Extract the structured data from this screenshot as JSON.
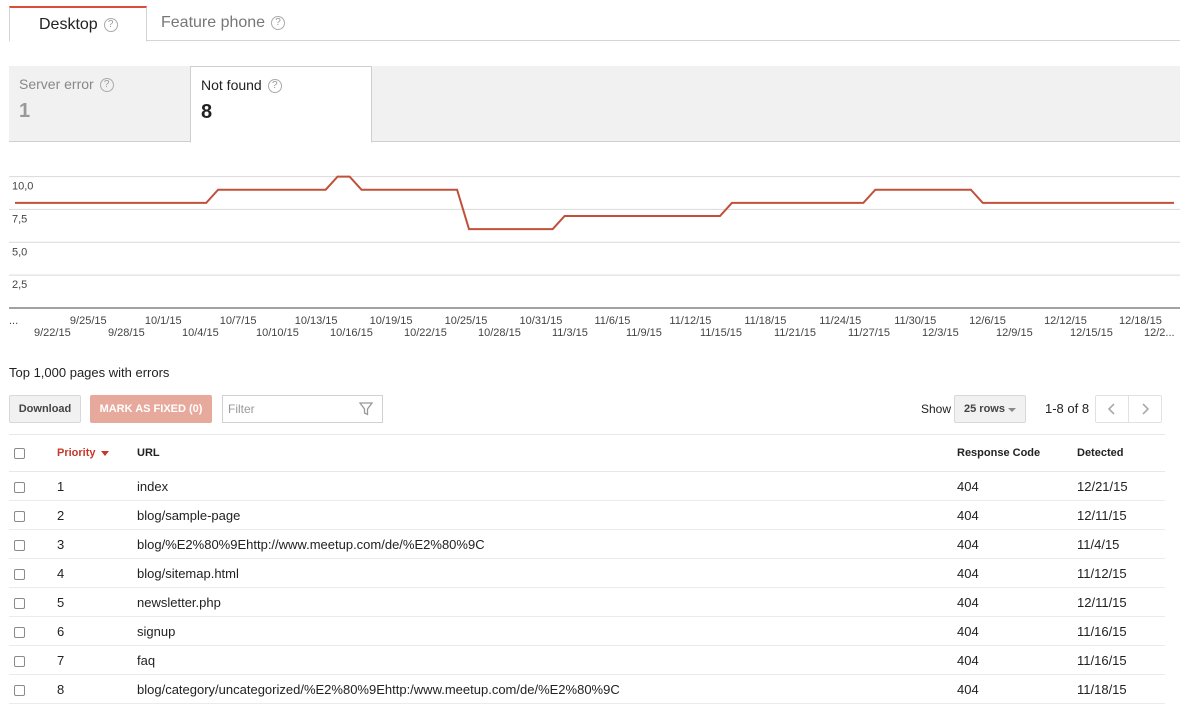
{
  "device_tabs": [
    {
      "label": "Desktop",
      "active": true
    },
    {
      "label": "Feature phone",
      "active": false
    }
  ],
  "help_glyph": "?",
  "error_tabs": [
    {
      "label": "Server error",
      "count": "1",
      "active": false
    },
    {
      "label": "Not found",
      "count": "8",
      "active": true
    }
  ],
  "colors": {
    "accent": "#dd4b39",
    "line": "#c0503a",
    "grid": "#d9d9d9"
  },
  "chart_data": {
    "type": "line",
    "y_ticks": [
      "10,0",
      "7,5",
      "5,0",
      "2,5"
    ],
    "ylim": [
      0,
      10.5
    ],
    "x_ticks_upper": [
      "...",
      "9/25/15",
      "10/1/15",
      "10/7/15",
      "10/13/15",
      "10/19/15",
      "10/25/15",
      "10/31/15",
      "11/6/15",
      "11/12/15",
      "11/18/15",
      "11/24/15",
      "11/30/15",
      "12/6/15",
      "12/12/15",
      "12/18/15"
    ],
    "x_ticks_lower": [
      "9/22/15",
      "9/28/15",
      "10/4/15",
      "10/10/15",
      "10/16/15",
      "10/22/15",
      "10/28/15",
      "11/3/15",
      "11/9/15",
      "11/15/15",
      "11/21/15",
      "11/27/15",
      "12/3/15",
      "12/9/15",
      "12/15/15",
      "12/2..."
    ],
    "grid": true,
    "series": [
      {
        "values": [
          {
            "x": "9/22/15",
            "y": 8
          },
          {
            "x": "10/8/15",
            "y": 8
          },
          {
            "x": "10/9/15",
            "y": 9
          },
          {
            "x": "10/18/15",
            "y": 9
          },
          {
            "x": "10/19/15",
            "y": 10
          },
          {
            "x": "10/20/15",
            "y": 10
          },
          {
            "x": "10/21/15",
            "y": 9
          },
          {
            "x": "10/29/15",
            "y": 9
          },
          {
            "x": "10/30/15",
            "y": 6
          },
          {
            "x": "11/6/15",
            "y": 6
          },
          {
            "x": "11/7/15",
            "y": 7
          },
          {
            "x": "11/20/15",
            "y": 7
          },
          {
            "x": "11/21/15",
            "y": 8
          },
          {
            "x": "12/2/15",
            "y": 8
          },
          {
            "x": "12/3/15",
            "y": 9
          },
          {
            "x": "12/11/15",
            "y": 9
          },
          {
            "x": "12/12/15",
            "y": 8
          },
          {
            "x": "12/28/15",
            "y": 8
          }
        ]
      }
    ]
  },
  "section_title": "Top 1,000 pages with errors",
  "toolbar": {
    "download_label": "Download",
    "mark_fixed_label": "MARK AS FIXED (0)",
    "filter_placeholder": "Filter",
    "show_label": "Show",
    "rows_value": "25 rows",
    "pager_text": "1-8 of 8"
  },
  "table": {
    "headers": {
      "priority": "Priority",
      "url": "URL",
      "response_code": "Response Code",
      "detected": "Detected"
    },
    "rows": [
      {
        "priority": "1",
        "url": "index",
        "code": "404",
        "detected": "12/21/15"
      },
      {
        "priority": "2",
        "url": "blog/sample-page",
        "code": "404",
        "detected": "12/11/15"
      },
      {
        "priority": "3",
        "url": "blog/%E2%80%9Ehttp://www.meetup.com/de/%E2%80%9C",
        "code": "404",
        "detected": "11/4/15"
      },
      {
        "priority": "4",
        "url": "blog/sitemap.html",
        "code": "404",
        "detected": "11/12/15"
      },
      {
        "priority": "5",
        "url": "newsletter.php",
        "code": "404",
        "detected": "12/11/15"
      },
      {
        "priority": "6",
        "url": "signup",
        "code": "404",
        "detected": "11/16/15"
      },
      {
        "priority": "7",
        "url": "faq",
        "code": "404",
        "detected": "11/16/15"
      },
      {
        "priority": "8",
        "url": "blog/category/uncategorized/%E2%80%9Ehttp:/www.meetup.com/de/%E2%80%9C",
        "code": "404",
        "detected": "11/18/15"
      }
    ]
  }
}
